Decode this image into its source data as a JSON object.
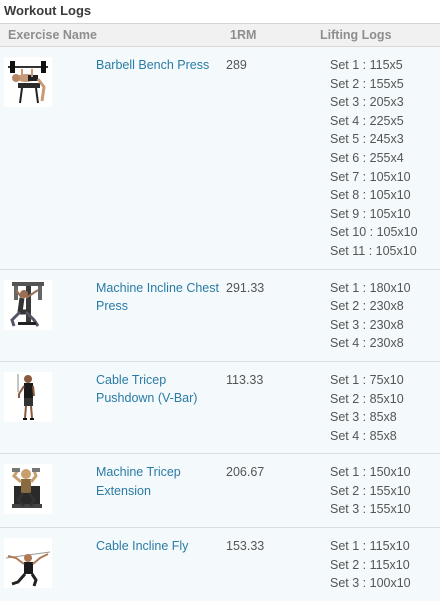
{
  "app": {
    "title": "Workout Logs"
  },
  "columns": {
    "exercise": "Exercise Name",
    "one_rm": "1RM",
    "logs": "Lifting Logs"
  },
  "exercises": [
    {
      "name": "Barbell Bench Press",
      "one_rm": "289",
      "image": "bench-press-photo",
      "sets": [
        "Set 1 : 115x5",
        "Set 2 : 155x5",
        "Set 3 : 205x3",
        "Set 4 : 225x5",
        "Set 5 : 245x3",
        "Set 6 : 255x4",
        "Set 7 : 105x10",
        "Set 8 : 105x10",
        "Set 9 : 105x10",
        "Set 10 : 105x10",
        "Set 11 : 105x10"
      ]
    },
    {
      "name": "Machine Incline Chest Press",
      "one_rm": "291.33",
      "image": "incline-press-photo",
      "sets": [
        "Set 1 : 180x10",
        "Set 2 : 230x8",
        "Set 3 : 230x8",
        "Set 4 : 230x8"
      ]
    },
    {
      "name": "Cable Tricep Pushdown (V-Bar)",
      "one_rm": "113.33",
      "image": "tricep-pushdown-photo",
      "sets": [
        "Set 1 : 75x10",
        "Set 2 : 85x10",
        "Set 3 : 85x8",
        "Set 4 : 85x8"
      ]
    },
    {
      "name": "Machine Tricep Extension",
      "one_rm": "206.67",
      "image": "tricep-extension-photo",
      "sets": [
        "Set 1 : 150x10",
        "Set 2 : 155x10",
        "Set 3 : 155x10"
      ]
    },
    {
      "name": "Cable Incline Fly",
      "one_rm": "153.33",
      "image": "incline-fly-photo",
      "sets": [
        "Set 1 : 115x10",
        "Set 2 : 115x10",
        "Set 3 : 100x10"
      ]
    }
  ]
}
